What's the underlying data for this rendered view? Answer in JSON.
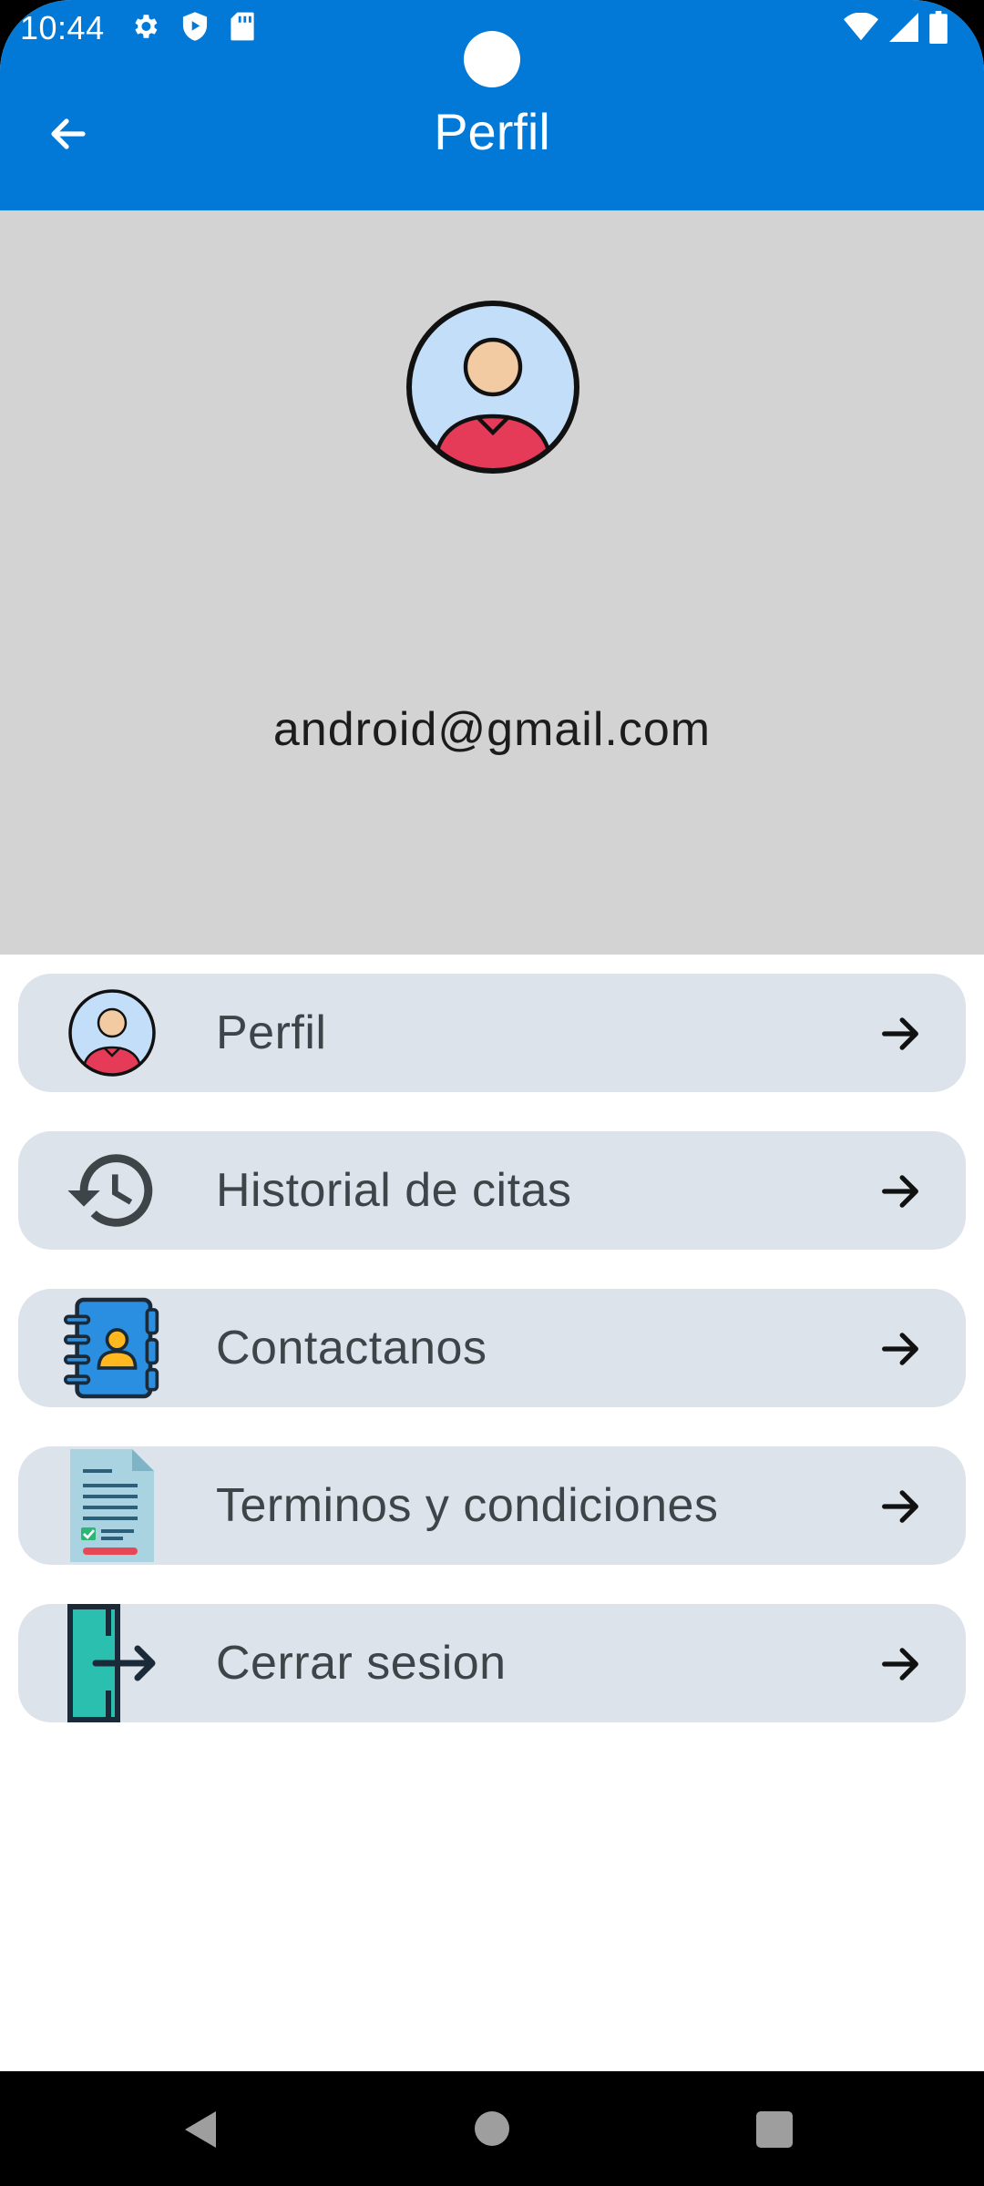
{
  "status_bar": {
    "time": "10:44",
    "left_icons": [
      "gear-icon",
      "shield-play-icon",
      "sd-card-icon"
    ],
    "right_icons": [
      "wifi-icon",
      "signal-icon",
      "battery-icon"
    ]
  },
  "app_bar": {
    "title": "Perfil",
    "back_icon": "arrow-left-icon",
    "color": "#0278d7"
  },
  "profile": {
    "email": "android@gmail.com",
    "avatar_icon": "user-avatar-icon",
    "header_color": "#d3d3d3"
  },
  "menu": {
    "items": [
      {
        "label": "Perfil",
        "icon": "user-avatar-icon"
      },
      {
        "label": "Historial de citas",
        "icon": "history-icon"
      },
      {
        "label": "Contactanos",
        "icon": "contact-book-icon"
      },
      {
        "label": "Terminos y condiciones",
        "icon": "document-icon"
      },
      {
        "label": "Cerrar sesion",
        "icon": "logout-door-icon"
      }
    ],
    "arrow_icon": "arrow-right-icon",
    "item_color": "#dde3ea"
  },
  "nav_bar": {
    "buttons": [
      "back-triangle-icon",
      "home-circle-icon",
      "recents-square-icon"
    ]
  }
}
